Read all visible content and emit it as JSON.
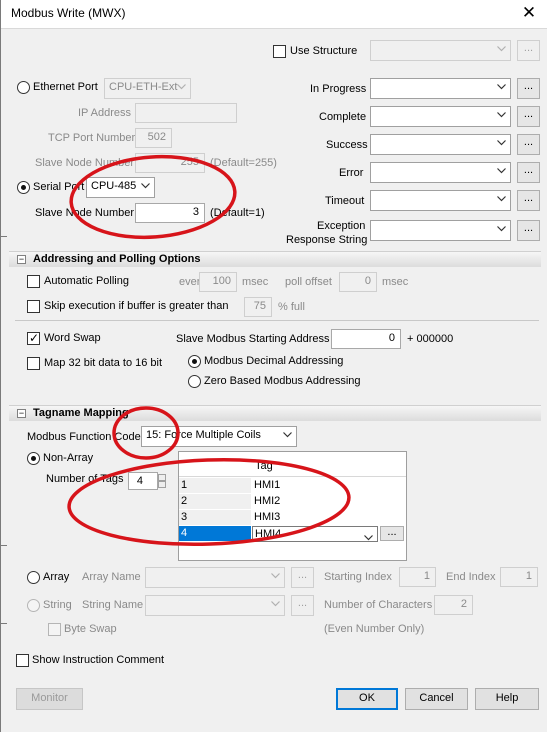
{
  "window": {
    "title": "Modbus Write (MWX)",
    "close_glyph": "✕"
  },
  "structure": {
    "use_structure_label": "Use Structure",
    "use_structure_checked": false,
    "combo_value": ""
  },
  "port": {
    "ethernet_label": "Ethernet Port",
    "ethernet_value": "CPU-ETH-Ext",
    "ip_label": "IP Address",
    "ip_value": "",
    "tcp_label": "TCP Port Number",
    "tcp_value": "502",
    "slave_node_label": "Slave Node Number",
    "slave_node_value": "255",
    "slave_node_default": "(Default=255)",
    "serial_label": "Serial Port",
    "serial_value": "CPU-485",
    "serial_node_label": "Slave Node Number",
    "serial_node_value": "3",
    "serial_node_default": "(Default=1)",
    "selected": "serial"
  },
  "status_fields": [
    {
      "label": "In Progress",
      "value": ""
    },
    {
      "label": "Complete",
      "value": ""
    },
    {
      "label": "Success",
      "value": ""
    },
    {
      "label": "Error",
      "value": ""
    },
    {
      "label": "Timeout",
      "value": ""
    },
    {
      "label1": "Exception",
      "label2": "Response String",
      "value": ""
    }
  ],
  "ellipsis": "...",
  "addressing": {
    "title": "Addressing and Polling Options",
    "toggle": "−",
    "auto_polling_label": "Automatic Polling",
    "every_label": "every",
    "every_value": "100",
    "msec": "msec",
    "poll_offset_label": "poll offset",
    "poll_offset_value": "0",
    "skip_label": "Skip execution if buffer is greater than",
    "skip_value": "75",
    "percent_full": "% full",
    "word_swap_label": "Word Swap",
    "word_swap_checked": true,
    "map32_label": "Map 32 bit data to 16 bit",
    "slave_start_label": "Slave Modbus Starting Address",
    "slave_start_value": "0",
    "slave_start_suffix": "+ 000000",
    "decimal_label": "Modbus Decimal Addressing",
    "zero_based_label": "Zero Based Modbus Addressing",
    "addressing_selected": "decimal"
  },
  "tagname": {
    "title": "Tagname Mapping",
    "toggle": "−",
    "function_code_label": "Modbus Function Code",
    "function_code_value": "15: Force Multiple Coils",
    "non_array_label": "Non-Array",
    "number_of_tags_label": "Number of Tags",
    "number_of_tags_value": "4",
    "grid_header": "Tag",
    "rows": [
      {
        "n": "1",
        "tag": "HMI1"
      },
      {
        "n": "2",
        "tag": "HMI2"
      },
      {
        "n": "3",
        "tag": "HMI3"
      },
      {
        "n": "4",
        "tag": "HMI4"
      }
    ],
    "selected_row": 4,
    "array_label": "Array",
    "array_name_label": "Array Name",
    "array_name_value": "",
    "starting_index_label": "Starting Index",
    "starting_index_value": "1",
    "end_index_label": "End Index",
    "end_index_value": "1",
    "string_label": "String",
    "string_name_label": "String Name",
    "string_name_value": "",
    "num_chars_label": "Number of Characters",
    "num_chars_value": "2",
    "byte_swap_label": "Byte Swap",
    "even_only": "(Even Number Only)",
    "mode_selected": "non-array"
  },
  "comment": {
    "label": "Show Instruction Comment",
    "checked": false
  },
  "buttons": {
    "monitor": "Monitor",
    "ok": "OK",
    "cancel": "Cancel",
    "help": "Help"
  },
  "colors": {
    "selection": "#0078d7",
    "annotation": "#d7141a",
    "focus": "#0078d7"
  }
}
